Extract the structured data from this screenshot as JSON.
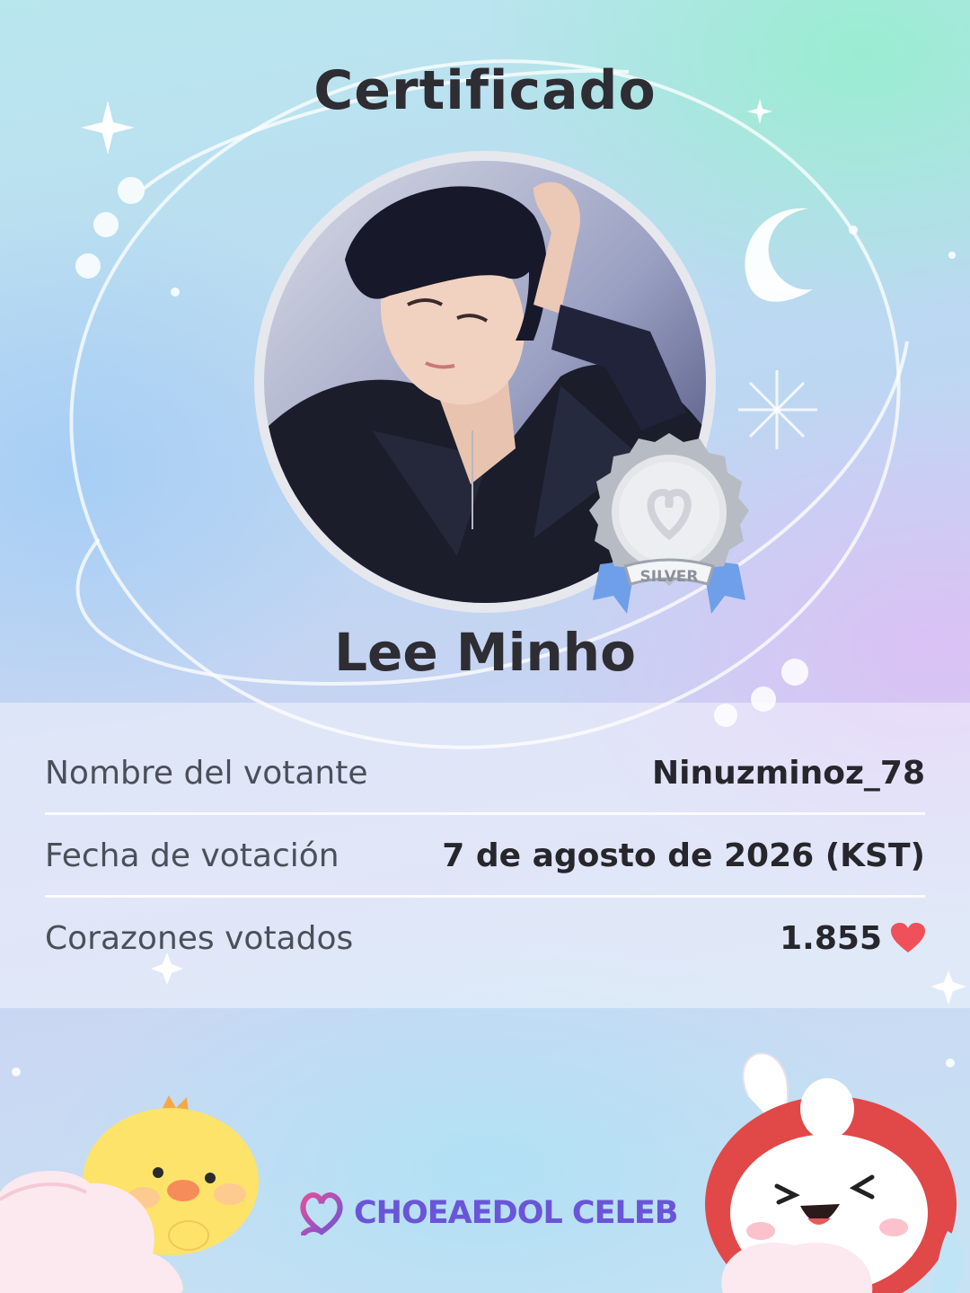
{
  "header": {
    "title": "Certificado"
  },
  "celebrity": {
    "name": "Lee Minho"
  },
  "medal": {
    "label": "SILVER"
  },
  "details": {
    "voter_label": "Nombre del votante",
    "voter_value": "Ninuzminoz_78",
    "date_label": "Fecha de votación",
    "date_value": "7 de agosto de 2026 (KST)",
    "hearts_label": "Corazones votados",
    "hearts_value": "1.855"
  },
  "brand": {
    "name": "CHOEAEDOL CELEB"
  },
  "colors": {
    "title_text": "#2d2d33",
    "heart": "#f0505a",
    "brand": "#6a55d8",
    "medal_silver": "#c9ccd2",
    "medal_ribbon": "#6f9fe8"
  },
  "icons": [
    "sparkle-icon",
    "moon-icon",
    "silver-medal-icon",
    "heart-icon",
    "brand-logo-icon",
    "chick-mascot",
    "bunny-mascot"
  ]
}
